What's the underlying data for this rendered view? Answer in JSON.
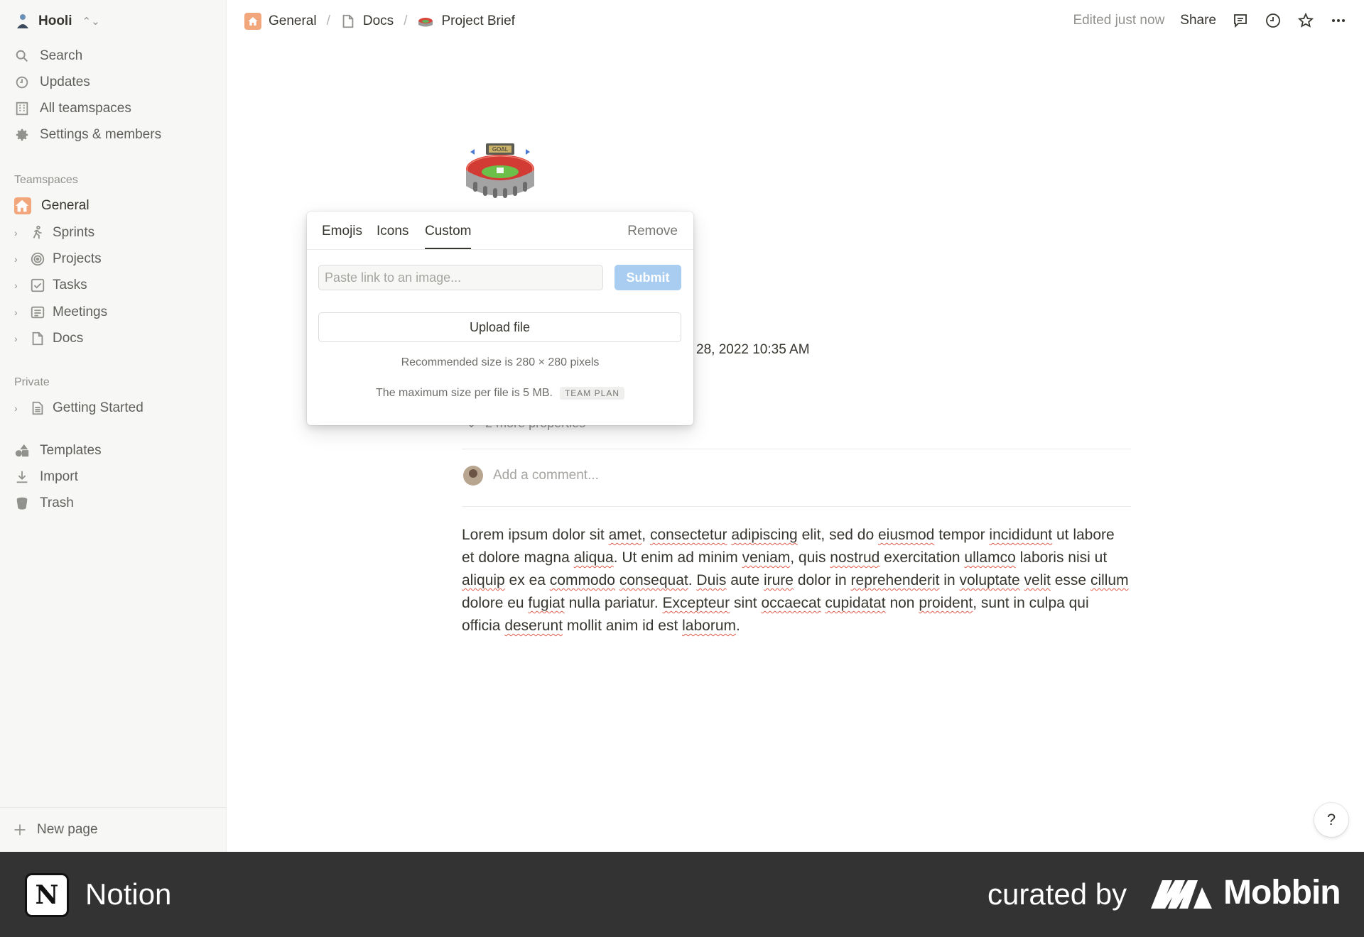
{
  "workspace": {
    "name": "Hooli"
  },
  "sidebar": {
    "nav": [
      {
        "label": "Search",
        "icon": "search-icon"
      },
      {
        "label": "Updates",
        "icon": "clock-icon"
      },
      {
        "label": "All teamspaces",
        "icon": "building-icon"
      },
      {
        "label": "Settings & members",
        "icon": "gear-icon"
      }
    ],
    "teamspaces_label": "Teamspaces",
    "teamspaces": [
      {
        "label": "General",
        "icon": "home-icon"
      },
      {
        "label": "Sprints",
        "icon": "runner-icon"
      },
      {
        "label": "Projects",
        "icon": "target-icon"
      },
      {
        "label": "Tasks",
        "icon": "checkbox-icon"
      },
      {
        "label": "Meetings",
        "icon": "notes-icon"
      },
      {
        "label": "Docs",
        "icon": "page-icon"
      }
    ],
    "private_label": "Private",
    "private": [
      {
        "label": "Getting Started",
        "icon": "doc-icon"
      }
    ],
    "bottom": [
      {
        "label": "Templates",
        "icon": "templates-icon"
      },
      {
        "label": "Import",
        "icon": "download-icon"
      },
      {
        "label": "Trash",
        "icon": "trash-icon"
      }
    ],
    "new_page": "New page"
  },
  "breadcrumbs": [
    {
      "label": "General"
    },
    {
      "label": "Docs"
    },
    {
      "label": "Project Brief"
    }
  ],
  "topbar": {
    "edited": "Edited just now",
    "share": "Share"
  },
  "page": {
    "prop_value": "28, 2022 10:35 AM",
    "more_properties": "2 more properties",
    "comment_placeholder": "Add a comment...",
    "body": [
      {
        "t": "Lorem ipsum dolor sit "
      },
      {
        "t": "amet",
        "sq": true
      },
      {
        "t": ", "
      },
      {
        "t": "consectetur",
        "sq": true
      },
      {
        "t": " "
      },
      {
        "t": "adipiscing",
        "sq": true
      },
      {
        "t": " elit, sed do "
      },
      {
        "t": "eiusmod",
        "sq": true
      },
      {
        "t": " tempor "
      },
      {
        "t": "incididunt",
        "sq": true
      },
      {
        "t": " ut labore et dolore magna "
      },
      {
        "t": "aliqua",
        "sq": true
      },
      {
        "t": ". Ut enim ad minim "
      },
      {
        "t": "veniam",
        "sq": true
      },
      {
        "t": ", quis "
      },
      {
        "t": "nostrud",
        "sq": true
      },
      {
        "t": " exercitation "
      },
      {
        "t": "ullamco",
        "sq": true
      },
      {
        "t": " laboris nisi ut "
      },
      {
        "t": "aliquip",
        "sq": true
      },
      {
        "t": " ex ea "
      },
      {
        "t": "commodo",
        "sq": true
      },
      {
        "t": " "
      },
      {
        "t": "consequat",
        "sq": true
      },
      {
        "t": ". "
      },
      {
        "t": "Duis",
        "sq": true
      },
      {
        "t": " aute "
      },
      {
        "t": "irure",
        "sq": true
      },
      {
        "t": " dolor in "
      },
      {
        "t": "reprehenderit",
        "sq": true
      },
      {
        "t": " in "
      },
      {
        "t": "voluptate",
        "sq": true
      },
      {
        "t": " "
      },
      {
        "t": "velit",
        "sq": true
      },
      {
        "t": " esse "
      },
      {
        "t": "cillum",
        "sq": true
      },
      {
        "t": " dolore eu "
      },
      {
        "t": "fugiat",
        "sq": true
      },
      {
        "t": " nulla pariatur. "
      },
      {
        "t": "Excepteur",
        "sq": true
      },
      {
        "t": " sint "
      },
      {
        "t": "occaecat",
        "sq": true
      },
      {
        "t": " "
      },
      {
        "t": "cupidatat",
        "sq": true
      },
      {
        "t": " non "
      },
      {
        "t": "proident",
        "sq": true
      },
      {
        "t": ", sunt in culpa qui officia "
      },
      {
        "t": "deserunt",
        "sq": true
      },
      {
        "t": " mollit anim id est "
      },
      {
        "t": "laborum",
        "sq": true
      },
      {
        "t": "."
      }
    ]
  },
  "icon_picker": {
    "tabs": [
      "Emojis",
      "Icons",
      "Custom"
    ],
    "active_tab": "Custom",
    "remove": "Remove",
    "link_placeholder": "Paste link to an image...",
    "link_value": "",
    "submit": "Submit",
    "upload": "Upload file",
    "recommended": "Recommended size is 280 × 280 pixels",
    "max_size": "The maximum size per file is 5 MB.",
    "plan_badge": "TEAM PLAN"
  },
  "help": "?",
  "footer": {
    "app": "Notion",
    "curated": "curated by",
    "brand": "Mobbin"
  },
  "colors": {
    "accent": "#2383e2",
    "submit_disabled": "#a8cdf0",
    "home_badge": "#f1a77b",
    "footer_bg": "#333333"
  }
}
